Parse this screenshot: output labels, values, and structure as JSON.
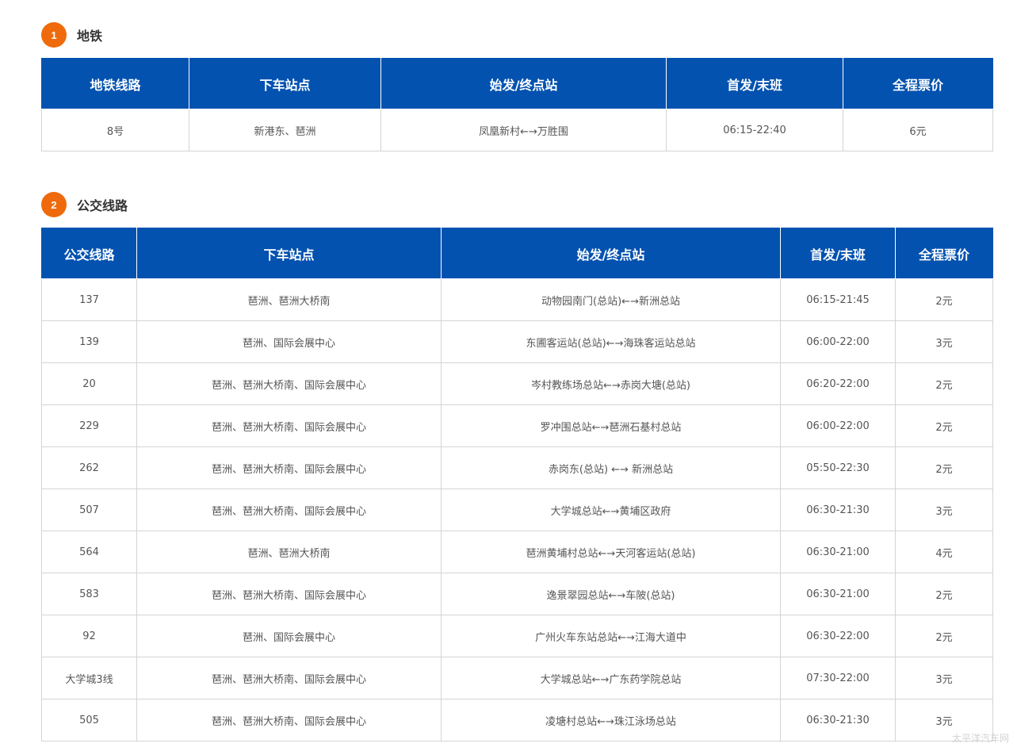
{
  "metro_section": {
    "number": "1",
    "title": "地铁",
    "headers": [
      "地铁线路",
      "下车站点",
      "始发/终点站",
      "首发/末班",
      "全程票价"
    ],
    "rows": [
      [
        "8号",
        "新港东、琶洲",
        "凤凰新村←→万胜围",
        "06:15-22:40",
        "6元"
      ]
    ]
  },
  "bus_section": {
    "number": "2",
    "title": "公交线路",
    "headers": [
      "公交线路",
      "下车站点",
      "始发/终点站",
      "首发/末班",
      "全程票价"
    ],
    "rows": [
      [
        "137",
        "琶洲、琶洲大桥南",
        "动物园南门(总站)←→新洲总站",
        "06:15-21:45",
        "2元"
      ],
      [
        "139",
        "琶洲、国际会展中心",
        "东圃客运站(总站)←→海珠客运站总站",
        "06:00-22:00",
        "3元"
      ],
      [
        "20",
        "琶洲、琶洲大桥南、国际会展中心",
        "岑村教练场总站←→赤岗大塘(总站)",
        "06:20-22:00",
        "2元"
      ],
      [
        "229",
        "琶洲、琶洲大桥南、国际会展中心",
        "罗冲围总站←→琶洲石基村总站",
        "06:00-22:00",
        "2元"
      ],
      [
        "262",
        "琶洲、琶洲大桥南、国际会展中心",
        "赤岗东(总站) ←→ 新洲总站",
        "05:50-22:30",
        "2元"
      ],
      [
        "507",
        "琶洲、琶洲大桥南、国际会展中心",
        "大学城总站←→黄埔区政府",
        "06:30-21:30",
        "3元"
      ],
      [
        "564",
        "琶洲、琶洲大桥南",
        "琶洲黄埔村总站←→天河客运站(总站)",
        "06:30-21:00",
        "4元"
      ],
      [
        "583",
        "琶洲、琶洲大桥南、国际会展中心",
        "逸景翠园总站←→车陂(总站)",
        "06:30-21:00",
        "2元"
      ],
      [
        "92",
        "琶洲、国际会展中心",
        "广州火车东站总站←→江海大道中",
        "06:30-22:00",
        "2元"
      ],
      [
        "大学城3线",
        "琶洲、琶洲大桥南、国际会展中心",
        "大学城总站←→广东药学院总站",
        "07:30-22:00",
        "3元"
      ],
      [
        "505",
        "琶洲、琶洲大桥南、国际会展中心",
        "凌塘村总站←→珠江泳场总站",
        "06:30-21:30",
        "3元"
      ]
    ]
  },
  "watermark": "太平洋汽车网",
  "colors": {
    "header_bg": "#0352b0",
    "badge_bg": "#ee6a0c",
    "border": "#d4d4d4"
  }
}
